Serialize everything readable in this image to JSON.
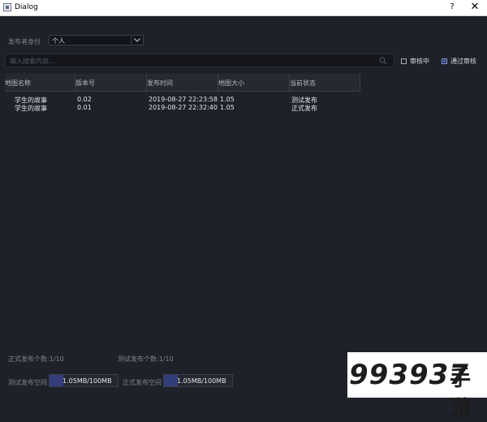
{
  "window": {
    "title": "Dialog",
    "help": "?",
    "close": "✕"
  },
  "publisher": {
    "label": "发布者身份",
    "value": "个人"
  },
  "search": {
    "placeholder": "输入搜索内容..."
  },
  "filters": [
    {
      "label": "审核中",
      "checked": false
    },
    {
      "label": "通过审核",
      "checked": true
    }
  ],
  "table": {
    "headers": [
      "地图名称",
      "版本号",
      "发布时间",
      "地图大小",
      "当前状态"
    ],
    "rows": [
      [
        "学生的故事",
        "0.02",
        "2019-08-27 22:23:58",
        "1.05",
        "测试发布"
      ],
      [
        "学生的故事",
        "0.01",
        "2019-08-27 22:32:40",
        "1.05",
        "正式发布"
      ]
    ]
  },
  "footer": {
    "official_count": "正式发布个数:1/10",
    "test_count": "测试发布个数:1/10",
    "test_space_label": "测试发布空间",
    "test_space_value": "1.05MB/100MB",
    "test_space_fraction": 0.2,
    "official_space_label": "正式发布空间",
    "official_space_value": "1.05MB/100MB",
    "official_space_fraction": 0.2
  },
  "watermark": {
    "text": "993937",
    "cn": "手游"
  }
}
